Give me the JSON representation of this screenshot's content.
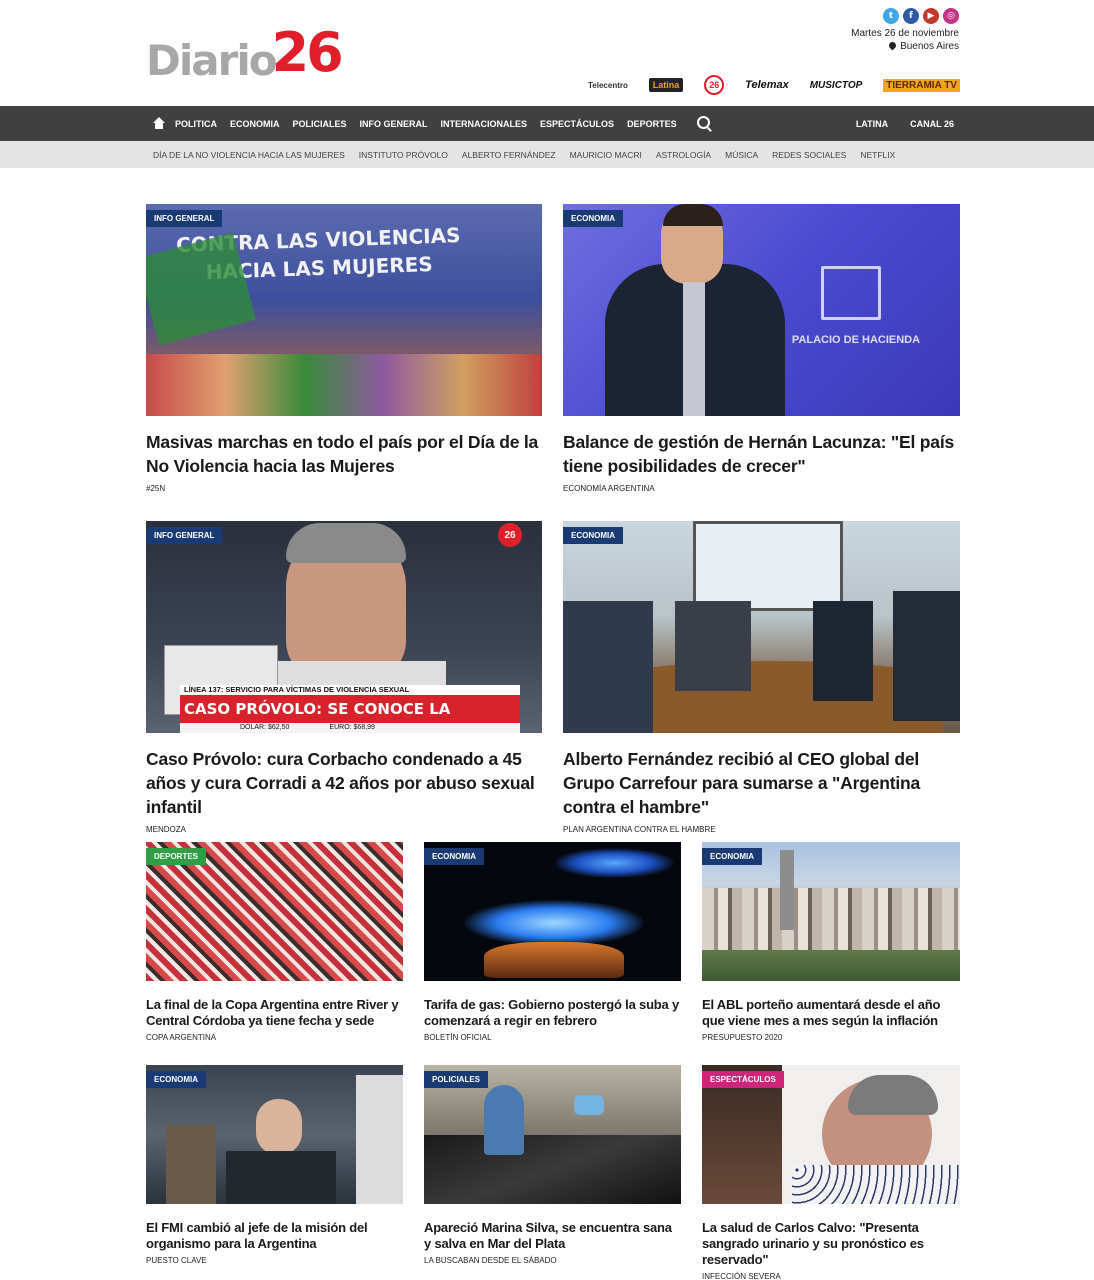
{
  "header": {
    "logo_word": "Diario",
    "logo_number": "26",
    "date": "Martes 26 de noviembre",
    "location": "Buenos Aires",
    "social": [
      {
        "icon": "twitter-icon",
        "glyph": "t"
      },
      {
        "icon": "facebook-icon",
        "glyph": "f"
      },
      {
        "icon": "youtube-icon",
        "glyph": "▶"
      },
      {
        "icon": "instagram-icon",
        "glyph": "◎"
      }
    ],
    "channels": [
      "Telecentro",
      "Latina",
      "26",
      "Telemax",
      "MUSICTOP",
      "TIERRAMIA TV"
    ]
  },
  "nav": {
    "items": [
      "POLITICA",
      "ECONOMIA",
      "POLICIALES",
      "INFO GENERAL",
      "INTERNACIONALES",
      "ESPECTÁCULOS",
      "DEPORTES"
    ],
    "right": [
      "LATINA",
      "CANAL 26"
    ]
  },
  "subnav": {
    "items": [
      "DÍA DE LA NO VIOLENCIA HACIA LAS MUJERES",
      "INSTITUTO PRÓVOLO",
      "ALBERTO FERNÁNDEZ",
      "MAURICIO MACRI",
      "ASTROLOGÍA",
      "MÚSICA",
      "REDES SOCIALES",
      "NETFLIX"
    ]
  },
  "articles": [
    {
      "section": "INFO GENERAL",
      "title": "Masivas marchas en todo el país por el Día de la No Violencia hacia las Mujeres",
      "kicker": "#25N",
      "banner": "CONTRA LAS VIOLENCIAS HACIA LAS MUJERES"
    },
    {
      "section": "ECONOMIA",
      "title": "Balance de gestión de Hernán Lacunza: \"El país tiene posibilidades de crecer\"",
      "kicker": "ECONOMÍA ARGENTINA",
      "banner": "PALACIO DE HACIENDA"
    },
    {
      "section": "INFO GENERAL",
      "title": "Caso Próvolo: cura Corbacho condenado a 45 años y cura Corradi a 42 años por abuso sexual infantil",
      "kicker": "MENDOZA",
      "banner_top": "LÍNEA 137: SERVICIO PARA VÍCTIMAS DE VIOLENCIA SEXUAL",
      "banner_main": "CASO PRÓVOLO: SE CONOCE LA SENTENCIA",
      "ticker_1": "DÓLAR: $62,50",
      "ticker_2": "EURO: $68,99"
    },
    {
      "section": "ECONOMIA",
      "title": "Alberto Fernández recibió al CEO global del Grupo Carrefour para sumarse a \"Argentina contra el hambre\"",
      "kicker": "PLAN ARGENTINA CONTRA EL HAMBRE"
    },
    {
      "section": "DEPORTES",
      "title": "La final de la Copa Argentina entre River y Central Córdoba ya tiene fecha y sede",
      "kicker": "COPA ARGENTINA"
    },
    {
      "section": "ECONOMIA",
      "title": "Tarifa de gas: Gobierno postergó la suba y comenzará a regir en febrero",
      "kicker": "BOLETÍN OFICIAL"
    },
    {
      "section": "ECONOMIA",
      "title": "El ABL porteño aumentará desde el año que viene mes a mes según la inflación",
      "kicker": "PRESUPUESTO 2020"
    },
    {
      "section": "ECONOMIA",
      "title": "El FMI cambió al jefe de la misión del organismo para la Argentina",
      "kicker": "PUESTO CLAVE"
    },
    {
      "section": "POLICIALES",
      "title": "Apareció Marina Silva, se encuentra sana y salva en Mar del Plata",
      "kicker": "LA BUSCABAN DESDE EL SÁBADO"
    },
    {
      "section": "ESPECTÁCULOS",
      "title": "La salud de Carlos Calvo: \"Presenta sangrado urinario y su pronóstico es reservado\"",
      "kicker": "INFECCIÓN SEVERA"
    }
  ],
  "colors": {
    "nav_bg": "#404040",
    "subnav_bg": "#e4e4e4",
    "brand_red": "#e11f2b",
    "badge_blue": "#1a3a73",
    "badge_green": "#2f9e44",
    "badge_pink": "#d0237a"
  }
}
